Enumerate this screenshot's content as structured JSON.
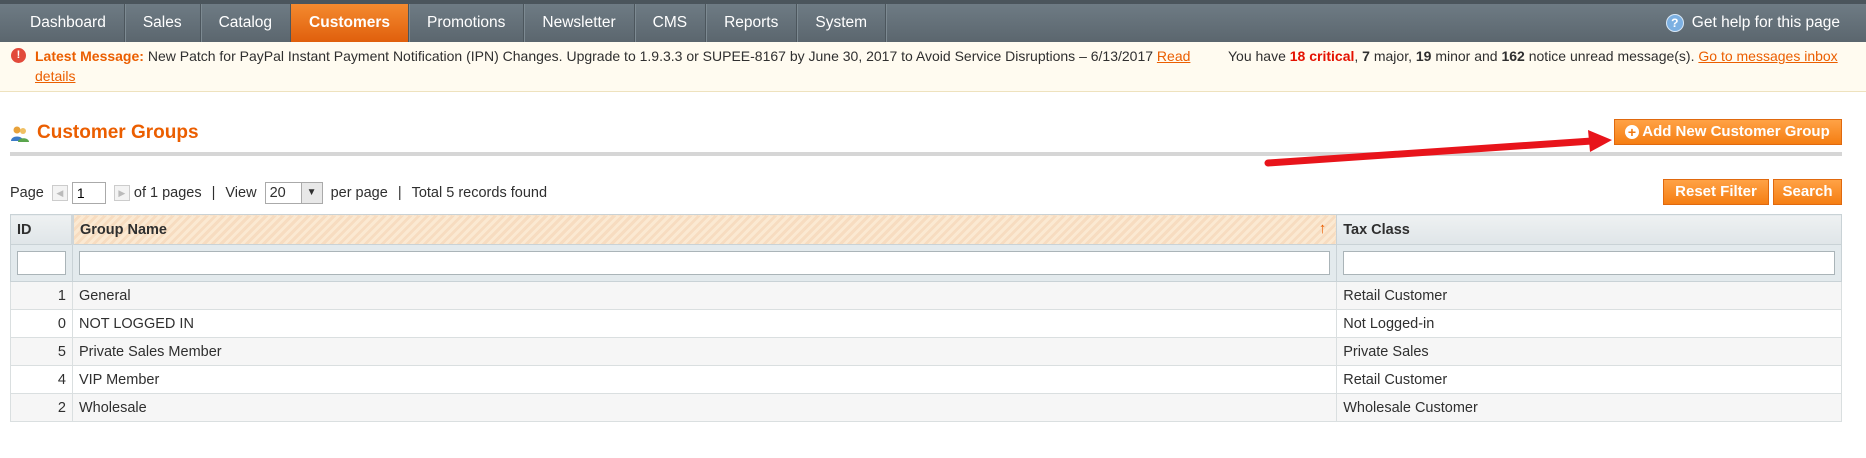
{
  "nav": {
    "items": [
      "Dashboard",
      "Sales",
      "Catalog",
      "Customers",
      "Promotions",
      "Newsletter",
      "CMS",
      "Reports",
      "System"
    ],
    "active": "Customers",
    "help": "Get help for this page"
  },
  "message": {
    "label": "Latest Message:",
    "text": "New Patch for PayPal Instant Payment Notification (IPN) Changes. Upgrade to 1.9.3.3 or SUPEE-8167 by June 30, 2017 to Avoid Service Disruptions – 6/13/2017",
    "link": "Read details",
    "summary_prefix": "You have",
    "critical": "18 critical",
    "major": "7",
    "major_label": "major,",
    "minor": "19",
    "minor_label": "minor and",
    "notice": "162",
    "notice_label": "notice unread message(s).",
    "inbox_link": "Go to messages inbox"
  },
  "page": {
    "title": "Customer Groups",
    "add_button": "Add New Customer Group"
  },
  "pager": {
    "page_label": "Page",
    "page_value": "1",
    "of_pages": "of 1 pages",
    "view_label": "View",
    "per_page_value": "20",
    "per_page_label": "per page",
    "total": "Total 5 records found",
    "reset_button": "Reset Filter",
    "search_button": "Search"
  },
  "grid": {
    "headers": {
      "id": "ID",
      "name": "Group Name",
      "tax": "Tax Class"
    },
    "rows": [
      {
        "id": "1",
        "name": "General",
        "tax": "Retail Customer"
      },
      {
        "id": "0",
        "name": "NOT LOGGED IN",
        "tax": "Not Logged-in"
      },
      {
        "id": "5",
        "name": "Private Sales Member",
        "tax": "Private Sales"
      },
      {
        "id": "4",
        "name": "VIP Member",
        "tax": "Retail Customer"
      },
      {
        "id": "2",
        "name": "Wholesale",
        "tax": "Wholesale Customer"
      }
    ]
  },
  "colors": {
    "accent": "#eb5e00",
    "nav": "#5b666e",
    "annotation_arrow": "#e8141b"
  }
}
